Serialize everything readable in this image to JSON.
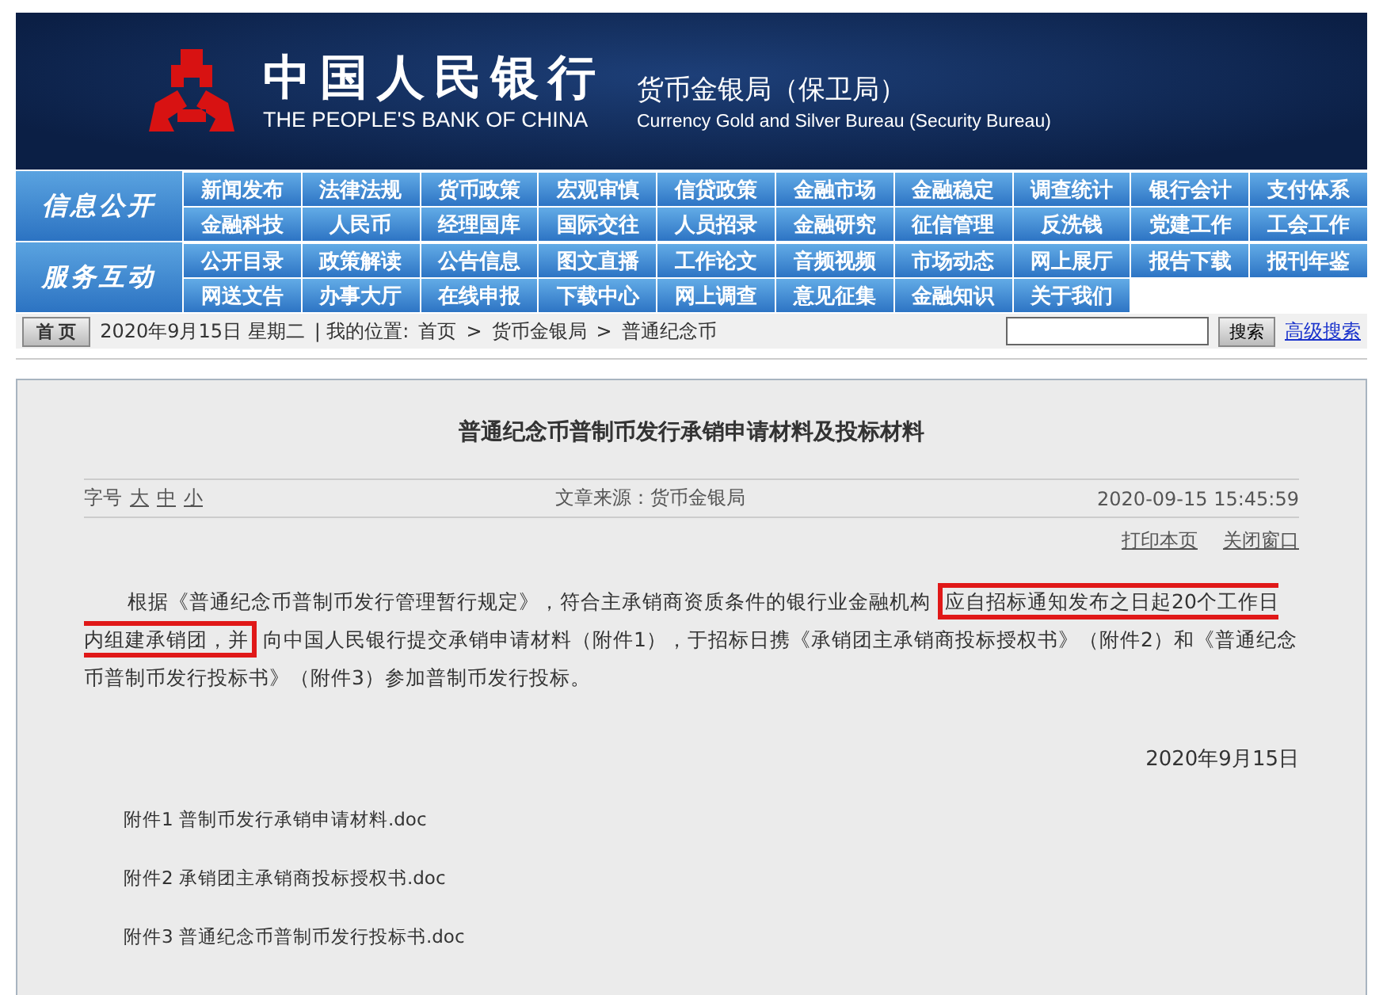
{
  "header": {
    "title_cn": "中国人民银行",
    "title_en": "THE PEOPLE'S BANK OF CHINA",
    "bureau_cn": "货币金银局（保卫局）",
    "bureau_en": "Currency  Gold and Silver Bureau (Security Bureau)"
  },
  "nav_groups": [
    {
      "label": "信息公开",
      "rows": [
        [
          "新闻发布",
          "法律法规",
          "货币政策",
          "宏观审慎",
          "信贷政策",
          "金融市场",
          "金融稳定",
          "调查统计",
          "银行会计",
          "支付体系"
        ],
        [
          "金融科技",
          "人民币",
          "经理国库",
          "国际交往",
          "人员招录",
          "金融研究",
          "征信管理",
          "反洗钱",
          "党建工作",
          "工会工作"
        ]
      ]
    },
    {
      "label": "服务互动",
      "rows": [
        [
          "公开目录",
          "政策解读",
          "公告信息",
          "图文直播",
          "工作论文",
          "音频视频",
          "市场动态",
          "网上展厅",
          "报告下载",
          "报刊年鉴"
        ],
        [
          "网送文告",
          "办事大厅",
          "在线申报",
          "下载中心",
          "网上调查",
          "意见征集",
          "金融知识",
          "关于我们"
        ]
      ]
    }
  ],
  "breadcrumb": {
    "home_button": "首 页",
    "date": "2020年9月15日 星期二",
    "location_label": "| 我的位置:",
    "trail": [
      "首页",
      "货币金银局",
      "普通纪念币"
    ],
    "separator": ">",
    "search_button": "搜索",
    "advanced_search": "高级搜索"
  },
  "article": {
    "title": "普通纪念币普制币发行承销申请材料及投标材料",
    "font_size_label": "字号",
    "font_sizes": [
      "大",
      "中",
      "小"
    ],
    "source": "文章来源：货币金银局",
    "datetime": "2020-09-15 15:45:59",
    "actions": [
      "打印本页",
      "关闭窗口"
    ],
    "paragraph": [
      {
        "text": "根据《普通纪念币普制币发行管理暂行规定》，符合主承销商资质条件的银行业金融机构",
        "highlighted": false
      },
      {
        "text": "应自招标通知发布之日起20个工作日内组建承销团，并",
        "highlighted": true
      },
      {
        "text": "向中国人民银行提交承销申请材料（附件1），于招标日携《承销团主承销商投标授权书》（附件2）和《普通纪念币普制币发行投标书》（附件3）参加普制币发行投标。",
        "highlighted": false
      }
    ],
    "date": "2020年9月15日",
    "attachments": [
      "附件1 普制币发行承销申请材料.doc",
      "附件2 承销团主承销商投标授权书.doc",
      "附件3 普通纪念币普制币发行投标书.doc"
    ]
  }
}
